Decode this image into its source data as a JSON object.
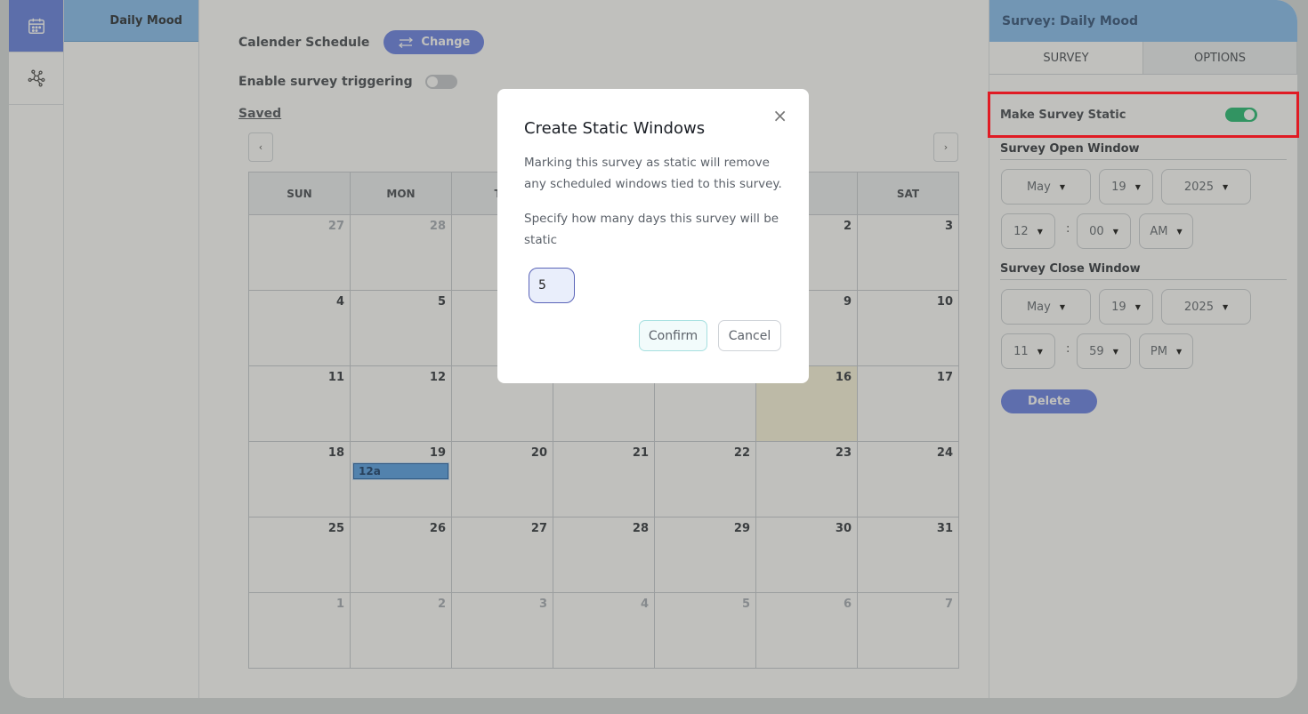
{
  "sidebar": {
    "rail": [
      {
        "icon": "calendar-icon"
      },
      {
        "icon": "network-icon"
      }
    ]
  },
  "survey_list": {
    "items": [
      {
        "label": "Daily Mood"
      }
    ]
  },
  "main": {
    "schedule_label": "Calender Schedule",
    "change_label": "Change",
    "trigger_label": "Enable survey triggering",
    "saved_label": "Saved",
    "prev": "‹",
    "next": "›"
  },
  "calendar": {
    "weekdays": [
      "SUN",
      "MON",
      "TU",
      "",
      "",
      "",
      "SAT"
    ],
    "weeks": [
      [
        "27",
        "28",
        "",
        "",
        "",
        "2",
        "3"
      ],
      [
        "4",
        "5",
        "",
        "",
        "",
        "9",
        "10"
      ],
      [
        "11",
        "12",
        "",
        "",
        "",
        "16",
        "17"
      ],
      [
        "18",
        "19",
        "20",
        "21",
        "22",
        "23",
        "24"
      ],
      [
        "25",
        "26",
        "27",
        "28",
        "29",
        "30",
        "31"
      ],
      [
        "1",
        "2",
        "3",
        "4",
        "5",
        "6",
        "7"
      ]
    ],
    "event_label": "12a"
  },
  "right_panel": {
    "title": "Survey: Daily Mood",
    "tabs": [
      "SURVEY",
      "OPTIONS"
    ],
    "static_label": "Make Survey Static",
    "open_window_label": "Survey Open Window",
    "close_window_label": "Survey Close Window",
    "open": {
      "month": "May",
      "day": "19",
      "year": "2025",
      "hour": "12",
      "minute": "00",
      "ampm": "AM"
    },
    "close": {
      "month": "May",
      "day": "19",
      "year": "2025",
      "hour": "11",
      "minute": "59",
      "ampm": "PM"
    },
    "colon": ":",
    "delete_label": "Delete"
  },
  "modal": {
    "title": "Create Static Windows",
    "close": "×",
    "text1": "Marking this survey as static will remove any scheduled windows tied to this survey.",
    "text2": "Specify how many days this survey will be static",
    "days_value": "5",
    "confirm_label": "Confirm",
    "cancel_label": "Cancel"
  },
  "colors": {
    "accent": "#6f86e8",
    "header_blue": "#8dc1f2",
    "toggle_on": "#2fbf7a",
    "highlight": "#e01b24"
  }
}
